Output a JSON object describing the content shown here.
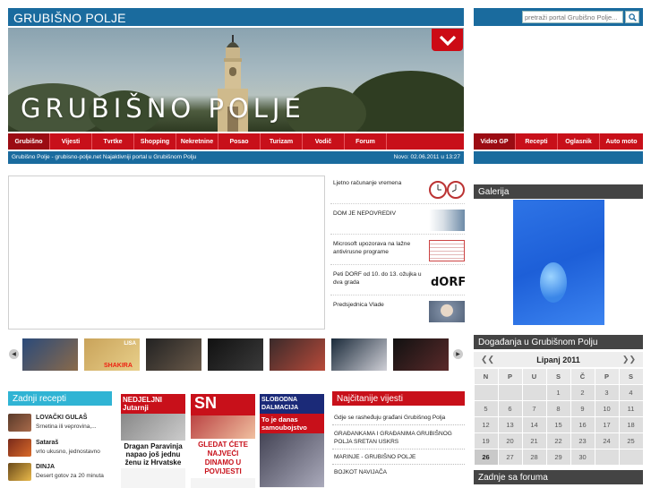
{
  "header": {
    "title": "GRUBIŠNO POLJE",
    "search_placeholder": "pretraži portal Grubišno Polje..."
  },
  "banner": {
    "title": "GRUBIŠNO POLJE"
  },
  "nav": {
    "main": [
      "Grubišno",
      "Vijesti",
      "Tvrtke",
      "Shopping",
      "Nekretnine",
      "Posao",
      "Turizam",
      "Vodič",
      "Forum"
    ],
    "side": [
      "Video GP",
      "Recepti",
      "Oglasnik",
      "Auto moto"
    ]
  },
  "ticker": {
    "left": "Grubišno Polje - grubisno-polje.net Najaktivniji portal u Grubišnom Polju",
    "right": "Novo: 02.06.2011  u  13:27"
  },
  "news": [
    {
      "title": "Ljetno računanje vremena"
    },
    {
      "title": "DOM JE NEPOVREDIV"
    },
    {
      "title": "Microsoft upozorava na lažne antivirusne programe"
    },
    {
      "title": "Peti DORF od 10. do 13. ožujka u dva grada"
    },
    {
      "title": "Predsjednica Vlade"
    }
  ],
  "carousel": {
    "thumb_labels": [
      "",
      "LISA",
      "",
      "",
      "",
      "",
      ""
    ],
    "shakira": "SHAKIRA"
  },
  "recipes": {
    "heading": "Zadnji recepti",
    "items": [
      {
        "title": "LOVAČKI GULAŠ",
        "desc": "Srnetina ili veprovina,..."
      },
      {
        "title": "Sataraš",
        "desc": "vrlo ukusno, jednostavno"
      },
      {
        "title": "DINJA",
        "desc": "Desert gotov za 20 minuta"
      }
    ]
  },
  "covers": {
    "c1_head": "NEDJELJNI Jutarnji",
    "c1_line": "Dragan Paravinja napao još jednu ženu iz Hrvatske",
    "c2_head": "SN",
    "c2_line": "GLEDAT ĆETE NAJVEĆI DINAMO U POVIJESTI",
    "c3_head": "SLOBODNA DALMACIJA",
    "c3_line": "To je danas samoubojstvo"
  },
  "most_read": {
    "heading": "Najčitanije vijesti",
    "items": [
      "Gdje se rasheđuju građani Grubišnog Polja",
      "GRAĐANKAMA I GRAĐANIMA GRUBIŠNOG POLJA SRETAN USKRS",
      "MARINJE - GRUBIŠNO POLJE",
      "BOJKOT NAVIJAČA"
    ]
  },
  "gallery": {
    "heading": "Galerija"
  },
  "calendar": {
    "heading": "Događanja u Grubišnom Polju",
    "month": "Lipanj 2011",
    "prev": "❮❮",
    "next": "❯❯",
    "days": [
      "N",
      "P",
      "U",
      "S",
      "Č",
      "P",
      "S"
    ],
    "weeks": [
      [
        "",
        "",
        "",
        "1",
        "2",
        "3",
        "4"
      ],
      [
        "5",
        "6",
        "7",
        "8",
        "9",
        "10",
        "11"
      ],
      [
        "12",
        "13",
        "14",
        "15",
        "16",
        "17",
        "18"
      ],
      [
        "19",
        "20",
        "21",
        "22",
        "23",
        "24",
        "25"
      ],
      [
        "26",
        "27",
        "28",
        "29",
        "30",
        "",
        ""
      ]
    ],
    "today": "26"
  },
  "forum": {
    "heading": "Zadnje sa foruma"
  },
  "colors": {
    "blue": "#1a6b9e",
    "red": "#c8101a",
    "cyan": "#30b4d4",
    "dark": "#444444"
  }
}
